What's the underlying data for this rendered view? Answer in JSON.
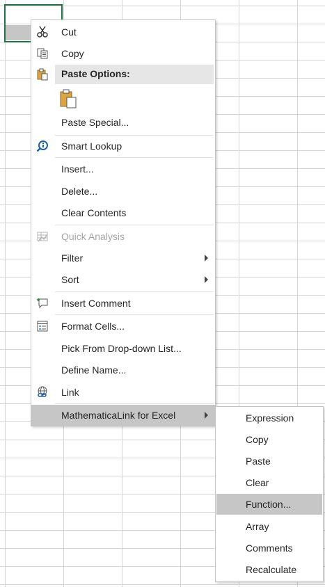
{
  "context_menu": {
    "items": [
      {
        "label": "Cut",
        "icon": "scissors-icon"
      },
      {
        "label": "Copy",
        "icon": "copy-icon"
      },
      {
        "label": "Paste Options:",
        "icon": "paste-icon"
      },
      {
        "label": "",
        "icon": "paste-option-icon"
      },
      {
        "label": "Paste Special...",
        "icon": ""
      },
      {
        "label": "Smart Lookup",
        "icon": "smart-lookup-icon"
      },
      {
        "label": "Insert...",
        "icon": ""
      },
      {
        "label": "Delete...",
        "icon": ""
      },
      {
        "label": "Clear Contents",
        "icon": ""
      },
      {
        "label": "Quick Analysis",
        "icon": "quick-analysis-icon",
        "disabled": true
      },
      {
        "label": "Filter",
        "icon": "",
        "submenu": true
      },
      {
        "label": "Sort",
        "icon": "",
        "submenu": true
      },
      {
        "label": "Insert Comment",
        "icon": "comment-icon"
      },
      {
        "label": "Format Cells...",
        "icon": "format-cells-icon"
      },
      {
        "label": "Pick From Drop-down List...",
        "icon": ""
      },
      {
        "label": "Define Name...",
        "icon": ""
      },
      {
        "label": "Link",
        "icon": "link-icon"
      },
      {
        "label": "MathematicaLink for Excel",
        "icon": "",
        "submenu": true,
        "highlighted": true
      }
    ]
  },
  "submenu": {
    "items": [
      {
        "label": "Expression"
      },
      {
        "label": "Copy"
      },
      {
        "label": "Paste"
      },
      {
        "label": "Clear"
      },
      {
        "label": "Function...",
        "highlighted": true
      },
      {
        "label": "Array"
      },
      {
        "label": "Comments"
      },
      {
        "label": "Recalculate"
      }
    ]
  },
  "colors": {
    "hover": "#c6c6c6",
    "header_band": "#e6e6e6",
    "active_cell_border": "#217346",
    "smart_lookup_blue": "#1e5fa8"
  }
}
